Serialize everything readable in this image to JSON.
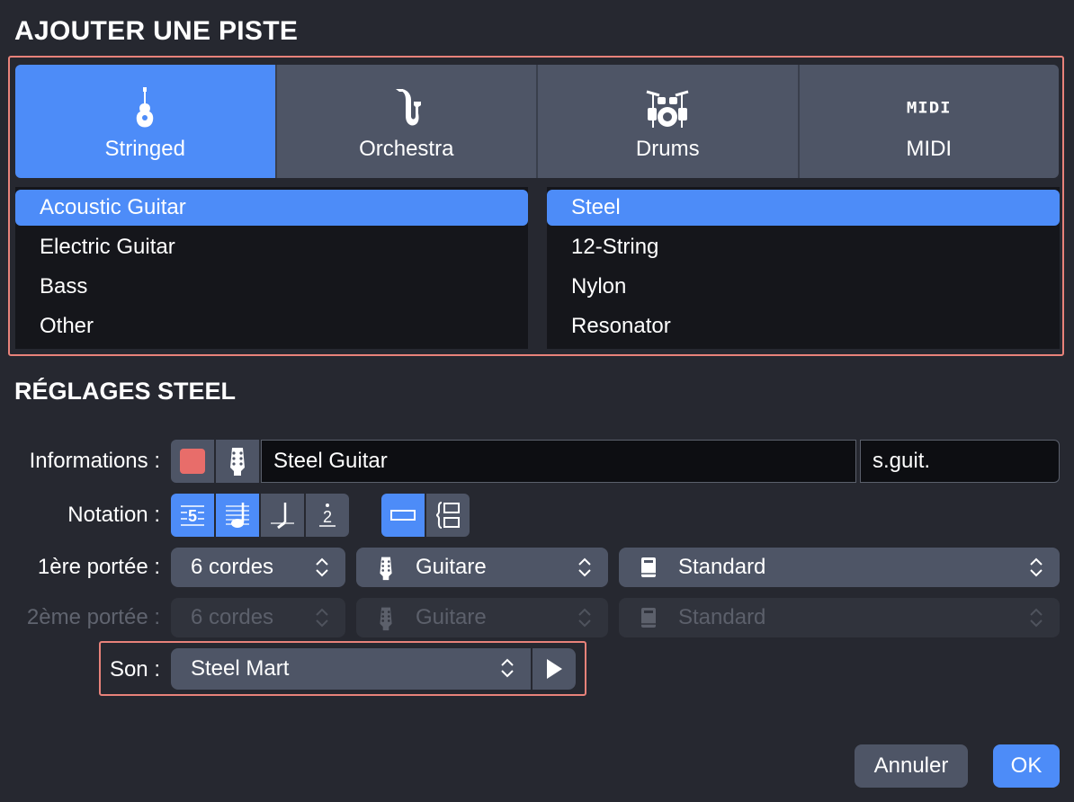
{
  "header": {
    "title": "AJOUTER UNE PISTE"
  },
  "categories": [
    {
      "label": "Stringed",
      "icon": "guitar-icon",
      "active": true
    },
    {
      "label": "Orchestra",
      "icon": "saxophone-icon",
      "active": false
    },
    {
      "label": "Drums",
      "icon": "drum-kit-icon",
      "active": false
    },
    {
      "label": "MIDI",
      "icon": "midi-icon",
      "active": false,
      "icon_text": "MIDI"
    }
  ],
  "instruments": [
    "Acoustic Guitar",
    "Electric Guitar",
    "Bass",
    "Other"
  ],
  "selected_instrument": "Acoustic Guitar",
  "variants": [
    "Steel",
    "12-String",
    "Nylon",
    "Resonator"
  ],
  "selected_variant": "Steel",
  "settings": {
    "title": "RÉGLAGES STEEL",
    "info_label": "Informations :",
    "color": "#e86d6a",
    "name_value": "Steel Guitar",
    "abbr_value": "s.guit.",
    "notation_label": "Notation :",
    "notation_digit": "5",
    "notation_fraction": "2",
    "staff1_label": "1ère portée :",
    "staff1_strings": "6 cordes",
    "staff1_instrument": "Guitare",
    "staff1_tuning": "Standard",
    "staff2_label": "2ème portée :",
    "staff2_strings": "6 cordes",
    "staff2_instrument": "Guitare",
    "staff2_tuning": "Standard",
    "sound_label": "Son :",
    "sound_value": "Steel Mart"
  },
  "buttons": {
    "cancel": "Annuler",
    "ok": "OK"
  },
  "colors": {
    "accent": "#4d8cf8",
    "panel": "#4e5566",
    "background": "#262830",
    "highlight_frame": "#e8827a"
  }
}
